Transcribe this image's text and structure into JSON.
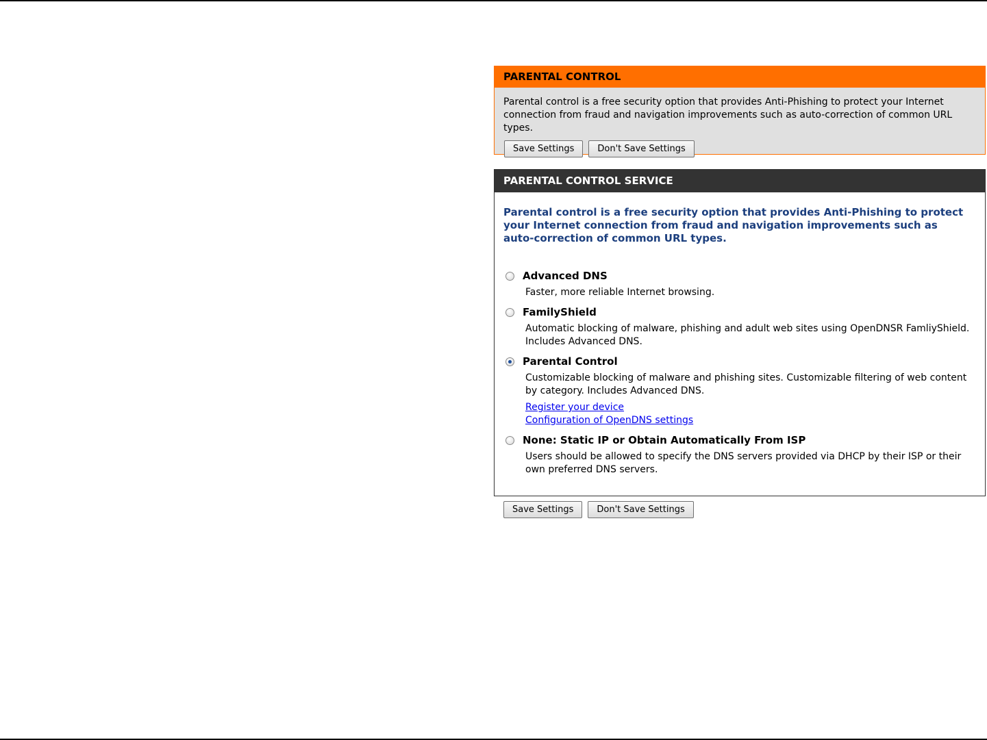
{
  "parental_control": {
    "title": "PARENTAL CONTROL",
    "description": "Parental control is a free security option that provides Anti-Phishing to protect your Internet connection from fraud and navigation improvements such as auto-correction of common URL types.",
    "save_label": "Save Settings",
    "dont_save_label": "Don't Save Settings"
  },
  "service": {
    "title": "PARENTAL CONTROL SERVICE",
    "intro": "Parental control is a free security option that provides Anti-Phishing to protect your Internet connection from fraud and navigation improvements such as auto-correction of common URL types.",
    "options": [
      {
        "title": "Advanced DNS",
        "description": "Faster, more reliable Internet browsing.",
        "checked": false
      },
      {
        "title": "FamilyShield",
        "description": "Automatic blocking of malware, phishing and adult web sites using OpenDNSR FamliyShield. Includes Advanced DNS.",
        "checked": false
      },
      {
        "title": "Parental Control",
        "description": "Customizable blocking of malware and phishing sites. Customizable filtering of web content by category. Includes Advanced DNS.",
        "checked": true,
        "links": [
          "Register your device",
          "Configuration of OpenDNS settings"
        ]
      },
      {
        "title": "None: Static IP or Obtain Automatically From ISP",
        "description": "Users should be allowed to specify the DNS servers provided via DHCP by their ISP or their own preferred DNS servers.",
        "checked": false
      }
    ]
  },
  "bottom": {
    "save_label": "Save Settings",
    "dont_save_label": "Don't Save Settings"
  },
  "colors": {
    "accent_orange": "#ff6f00",
    "header_dark": "#333333",
    "intro_blue": "#1c3f7e",
    "link_blue": "#0000ee"
  }
}
